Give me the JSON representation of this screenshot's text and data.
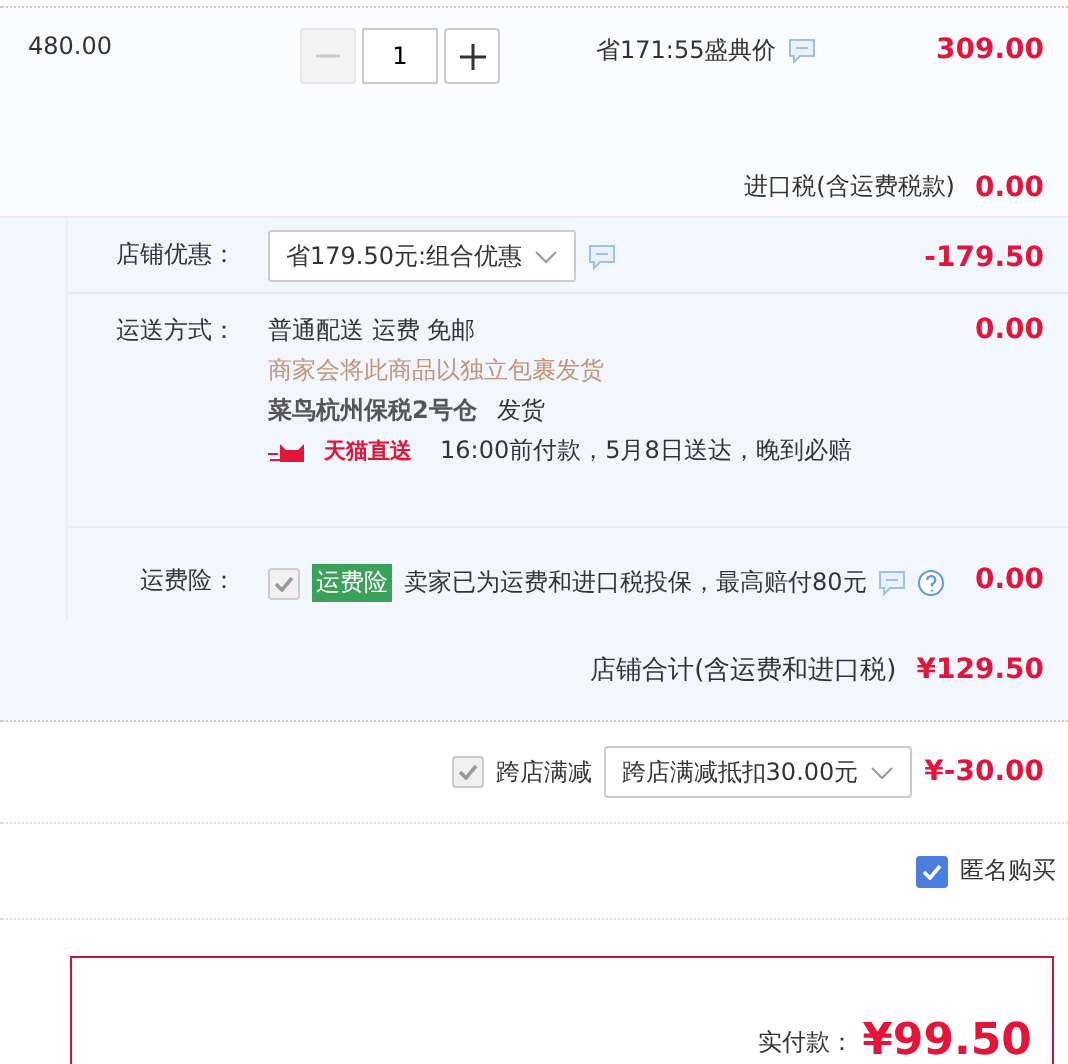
{
  "item": {
    "unit_price": "480.00",
    "quantity": "1",
    "minus_disabled": true,
    "promo_text": "省171:55盛典价",
    "price": "309.00"
  },
  "import_tax": {
    "label": "进口税(含运费税款)",
    "amount": "0.00"
  },
  "store_discount": {
    "label": "店铺优惠：",
    "select_value": "省179.50元:组合优惠",
    "amount": "-179.50"
  },
  "shipping": {
    "label": "运送方式：",
    "method": "普通配送 运费 免邮",
    "note": "商家会将此商品以独立包裹发货",
    "warehouse": "菜鸟杭州保税2号仓",
    "dispatch": "发货",
    "badge": "天猫直送",
    "delivery": "16:00前付款，5月8日送达，晚到必赔",
    "amount": "0.00"
  },
  "insurance": {
    "label": "运费险：",
    "checked": true,
    "disabled": true,
    "tag": "运费险",
    "text": "卖家已为运费和进口税投保，最高赔付80元",
    "amount": "0.00"
  },
  "store_total": {
    "label": "店铺合计(含运费和进口税)",
    "amount": "¥129.50"
  },
  "cross_store": {
    "checked": true,
    "disabled": true,
    "label": "跨店满减",
    "select_value": "跨店满减抵扣30.00元",
    "amount": "¥-30.00"
  },
  "anonymous": {
    "checked": true,
    "disabled": false,
    "label": "匿名购买"
  },
  "payment": {
    "label": "实付款：",
    "amount": "¥99.50"
  }
}
